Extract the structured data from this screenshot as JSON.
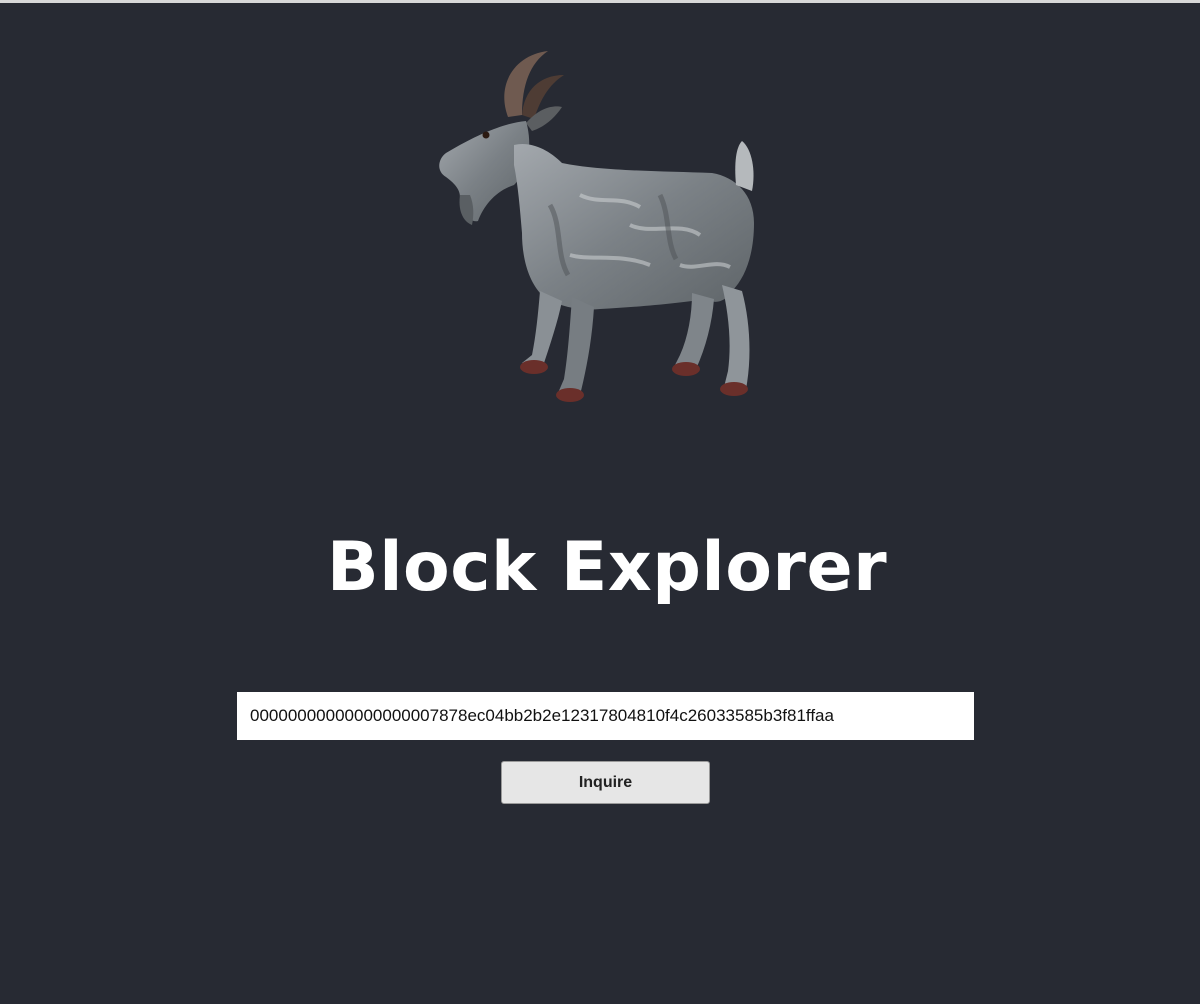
{
  "header": {
    "logo_icon": "goat-icon",
    "title": "Block Explorer"
  },
  "search": {
    "value": "00000000000000000007878ec04bb2b2e12317804810f4c26033585b3f81ffaa"
  },
  "actions": {
    "inquire_label": "Inquire"
  },
  "colors": {
    "background": "#272a33",
    "title": "#ffffff",
    "input_background": "#ffffff",
    "button_background": "#e6e6e6"
  }
}
